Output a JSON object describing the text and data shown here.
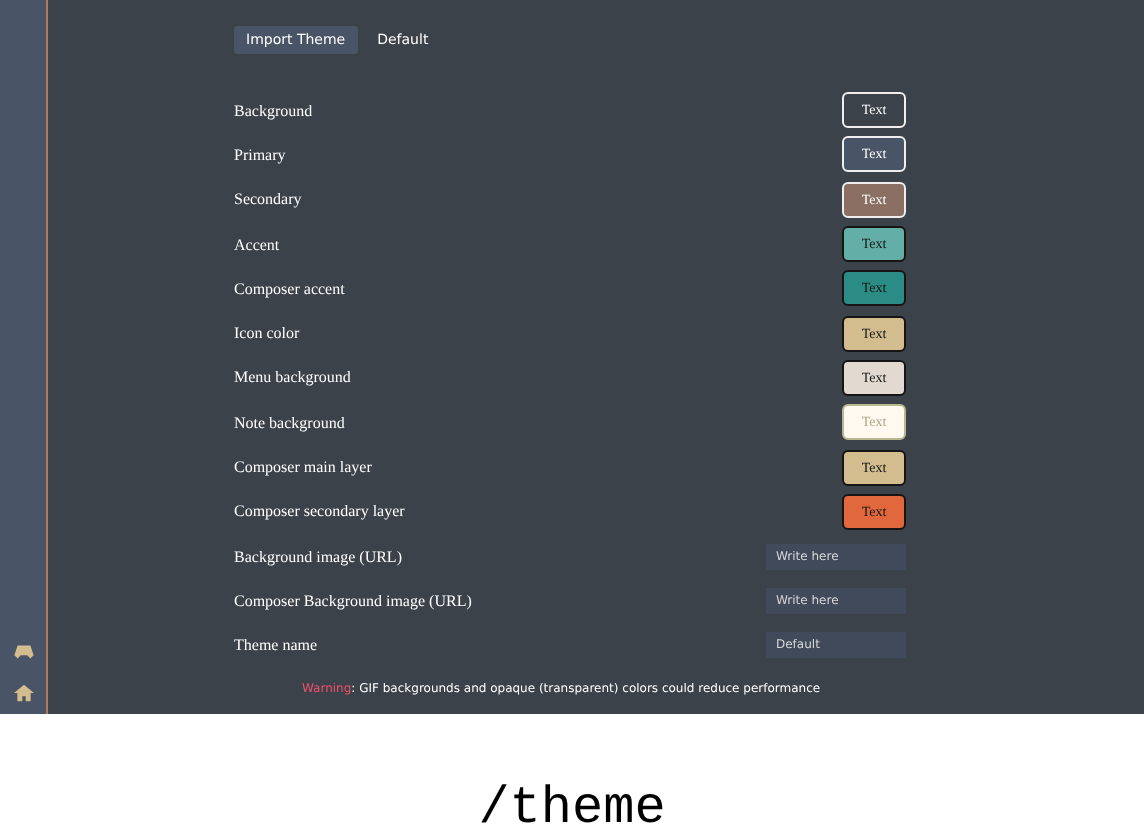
{
  "tabs": [
    {
      "label": "Import Theme",
      "selected": true
    },
    {
      "label": "Default",
      "selected": false
    }
  ],
  "colors": [
    {
      "label": "Background",
      "button_text": "Text",
      "color": "#3b4249"
    },
    {
      "label": "Primary",
      "button_text": "Text",
      "color": "#495466"
    },
    {
      "label": "Secondary",
      "button_text": "Text",
      "color": "#8b6f62"
    },
    {
      "label": "Accent",
      "button_text": "Text",
      "color": "#63aea7"
    },
    {
      "label": "Composer accent",
      "button_text": "Text",
      "color": "#2a8c84"
    },
    {
      "label": "Icon color",
      "button_text": "Text",
      "color": "#d3bd8e"
    },
    {
      "label": "Menu background",
      "button_text": "Text",
      "color": "#e2dad0"
    },
    {
      "label": "Note background",
      "button_text": "Text",
      "color": "#fff9ef"
    },
    {
      "label": "Composer main layer",
      "button_text": "Text",
      "color": "#d3bd8e"
    },
    {
      "label": "Composer secondary layer",
      "button_text": "Text",
      "color": "#e1683d"
    }
  ],
  "inputs": [
    {
      "label": "Background image (URL)",
      "placeholder": "Write here"
    },
    {
      "label": "Composer Background image (URL)",
      "placeholder": "Write here"
    },
    {
      "label": "Theme name",
      "placeholder": "Default"
    }
  ],
  "warning": {
    "label": "Warning",
    "text": ": GIF backgrounds and opaque (transparent) colors could reduce performance"
  },
  "caption": "/theme"
}
